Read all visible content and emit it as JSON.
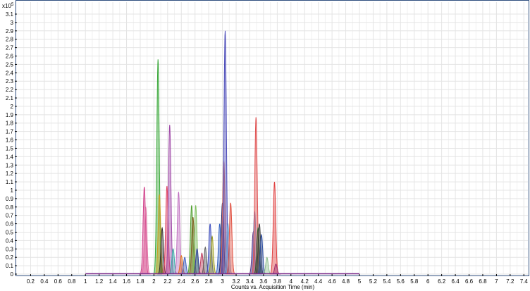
{
  "chart_data": {
    "type": "area",
    "xlabel": "Counts vs. Acquisition Time (min)",
    "ylabel_multiplier": "x10",
    "ylabel_exponent": "5",
    "xlim": [
      0,
      7.4
    ],
    "ylim": [
      0,
      3.2
    ],
    "x_ticks": [
      0.2,
      0.4,
      0.6,
      0.8,
      1,
      1.2,
      1.4,
      1.6,
      1.8,
      2,
      2.2,
      2.4,
      2.6,
      2.8,
      3,
      3.2,
      3.4,
      3.6,
      3.8,
      4,
      4.2,
      4.4,
      4.6,
      4.8,
      5,
      5.2,
      5.4,
      5.6,
      5.8,
      6,
      6.2,
      6.4,
      6.6,
      6.8,
      7,
      7.2,
      7.4
    ],
    "y_ticks": [
      0,
      0.1,
      0.2,
      0.3,
      0.4,
      0.5,
      0.6,
      0.7,
      0.8,
      0.9,
      1,
      1.1,
      1.2,
      1.3,
      1.4,
      1.5,
      1.6,
      1.7,
      1.8,
      1.9,
      2,
      2.1,
      2.2,
      2.3,
      2.4,
      2.5,
      2.6,
      2.7,
      2.8,
      2.9,
      3,
      3.1
    ],
    "grid": true,
    "baseline_range": [
      1.0,
      5.0
    ],
    "peaks": [
      {
        "x": 1.86,
        "y": 1.04,
        "color": "#d0408a"
      },
      {
        "x": 1.88,
        "y": 0.8,
        "color": "#e06aa0"
      },
      {
        "x": 2.06,
        "y": 2.56,
        "color": "#3aa83a"
      },
      {
        "x": 2.08,
        "y": 0.95,
        "color": "#c8a020"
      },
      {
        "x": 2.12,
        "y": 0.55,
        "color": "#303030"
      },
      {
        "x": 2.19,
        "y": 1.05,
        "color": "#e04060"
      },
      {
        "x": 2.23,
        "y": 1.78,
        "color": "#a04aa8"
      },
      {
        "x": 2.28,
        "y": 0.3,
        "color": "#3aa8a8"
      },
      {
        "x": 2.36,
        "y": 0.98,
        "color": "#c070c0"
      },
      {
        "x": 2.4,
        "y": 0.22,
        "color": "#e07020"
      },
      {
        "x": 2.45,
        "y": 0.2,
        "color": "#4060c0"
      },
      {
        "x": 2.55,
        "y": 0.82,
        "color": "#50a030"
      },
      {
        "x": 2.57,
        "y": 0.68,
        "color": "#806020"
      },
      {
        "x": 2.61,
        "y": 0.82,
        "color": "#80c060"
      },
      {
        "x": 2.63,
        "y": 0.3,
        "color": "#3040a0"
      },
      {
        "x": 2.7,
        "y": 0.25,
        "color": "#c04060"
      },
      {
        "x": 2.75,
        "y": 0.32,
        "color": "#606060"
      },
      {
        "x": 2.82,
        "y": 0.6,
        "color": "#4050c0"
      },
      {
        "x": 2.85,
        "y": 0.45,
        "color": "#a0a020"
      },
      {
        "x": 2.96,
        "y": 0.6,
        "color": "#3060c0"
      },
      {
        "x": 3.0,
        "y": 0.85,
        "color": "#202060"
      },
      {
        "x": 3.02,
        "y": 1.35,
        "color": "#e07060"
      },
      {
        "x": 3.04,
        "y": 2.9,
        "color": "#4a4ab8"
      },
      {
        "x": 3.08,
        "y": 0.6,
        "color": "#70a0d0"
      },
      {
        "x": 3.12,
        "y": 0.85,
        "color": "#e05040"
      },
      {
        "x": 3.45,
        "y": 0.5,
        "color": "#603080"
      },
      {
        "x": 3.47,
        "y": 0.75,
        "color": "#7090d0"
      },
      {
        "x": 3.49,
        "y": 1.87,
        "color": "#e05050"
      },
      {
        "x": 3.52,
        "y": 0.55,
        "color": "#306030"
      },
      {
        "x": 3.54,
        "y": 0.6,
        "color": "#404040"
      },
      {
        "x": 3.57,
        "y": 0.47,
        "color": "#3050a0"
      },
      {
        "x": 3.65,
        "y": 0.2,
        "color": "#90c090"
      },
      {
        "x": 3.76,
        "y": 1.1,
        "color": "#e04040"
      },
      {
        "x": 3.78,
        "y": 0.12,
        "color": "#a03070"
      }
    ]
  }
}
